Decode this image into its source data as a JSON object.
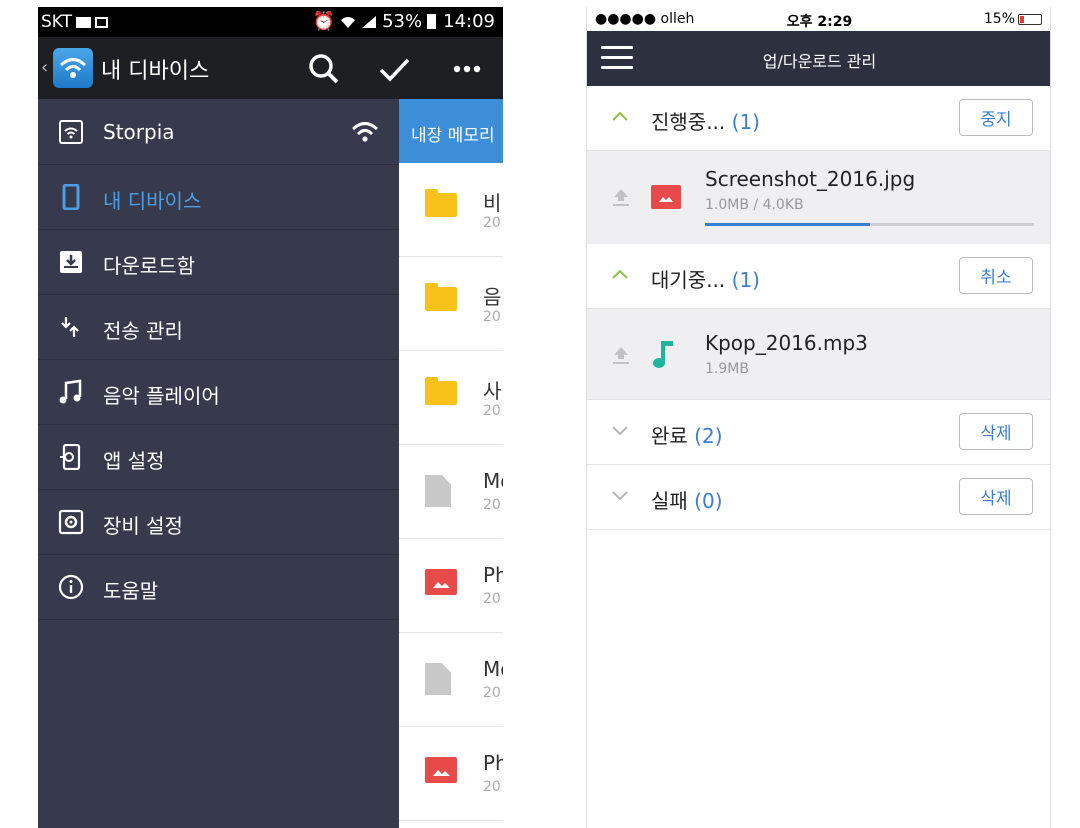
{
  "left": {
    "status": {
      "carrier": "SKT",
      "battery_pct": "53%",
      "time": "14:09"
    },
    "toolbar": {
      "title": "내 디바이스"
    },
    "tab_label": "내장 메모리",
    "drawer": {
      "items": [
        {
          "label": "Storpia",
          "icon": "wifi-icon"
        },
        {
          "label": "내 디바이스",
          "icon": "phone-icon"
        },
        {
          "label": "다운로드함",
          "icon": "download-box-icon"
        },
        {
          "label": "전송 관리",
          "icon": "transfer-icon"
        },
        {
          "label": "음악 플레이어",
          "icon": "music-note-icon"
        },
        {
          "label": "앱 설정",
          "icon": "app-settings-icon"
        },
        {
          "label": "장비 설정",
          "icon": "device-settings-icon"
        },
        {
          "label": "도움말",
          "icon": "info-icon"
        }
      ]
    },
    "files": [
      {
        "type": "folder",
        "name": "비",
        "date": "20"
      },
      {
        "type": "folder",
        "name": "음",
        "date": "20"
      },
      {
        "type": "folder",
        "name": "사",
        "date": "20"
      },
      {
        "type": "doc",
        "name": "Mo",
        "date": "20"
      },
      {
        "type": "photo",
        "name": "Ph",
        "date": "20"
      },
      {
        "type": "doc",
        "name": "Mo",
        "date": "20"
      },
      {
        "type": "photo",
        "name": "Ph",
        "date": "20"
      }
    ],
    "colors": {
      "drawer_bg": "#363a4c",
      "accent": "#4a9ee5",
      "folder": "#f7c31a",
      "photo": "#e84a4a"
    }
  },
  "right": {
    "status": {
      "carrier": "●●●●● olleh",
      "time": "오후 2:29",
      "battery_pct": "15%"
    },
    "nav": {
      "title": "업/다운로드 관리"
    },
    "sections": {
      "in_progress": {
        "label": "진행중...",
        "count": "(1)",
        "button": "중지"
      },
      "waiting": {
        "label": "대기중...",
        "count": "(1)",
        "button": "취소"
      },
      "done": {
        "label": "완료",
        "count": "(2)",
        "button": "삭제"
      },
      "failed": {
        "label": "실패",
        "count": "(0)",
        "button": "삭제"
      }
    },
    "uploading_file": {
      "name": "Screenshot_2016.jpg",
      "size": "1.0MB / 4.0KB",
      "progress": 0.5
    },
    "waiting_file": {
      "name": "Kpop_2016.mp3",
      "size": "1.9MB"
    },
    "colors": {
      "nav_bg": "#2d303f",
      "accent": "#3b7fd0",
      "expand_chevron": "#8bc34a",
      "collapse_chevron": "#b5b5b5",
      "music": "#1fb59a",
      "image": "#e84a4a"
    }
  }
}
